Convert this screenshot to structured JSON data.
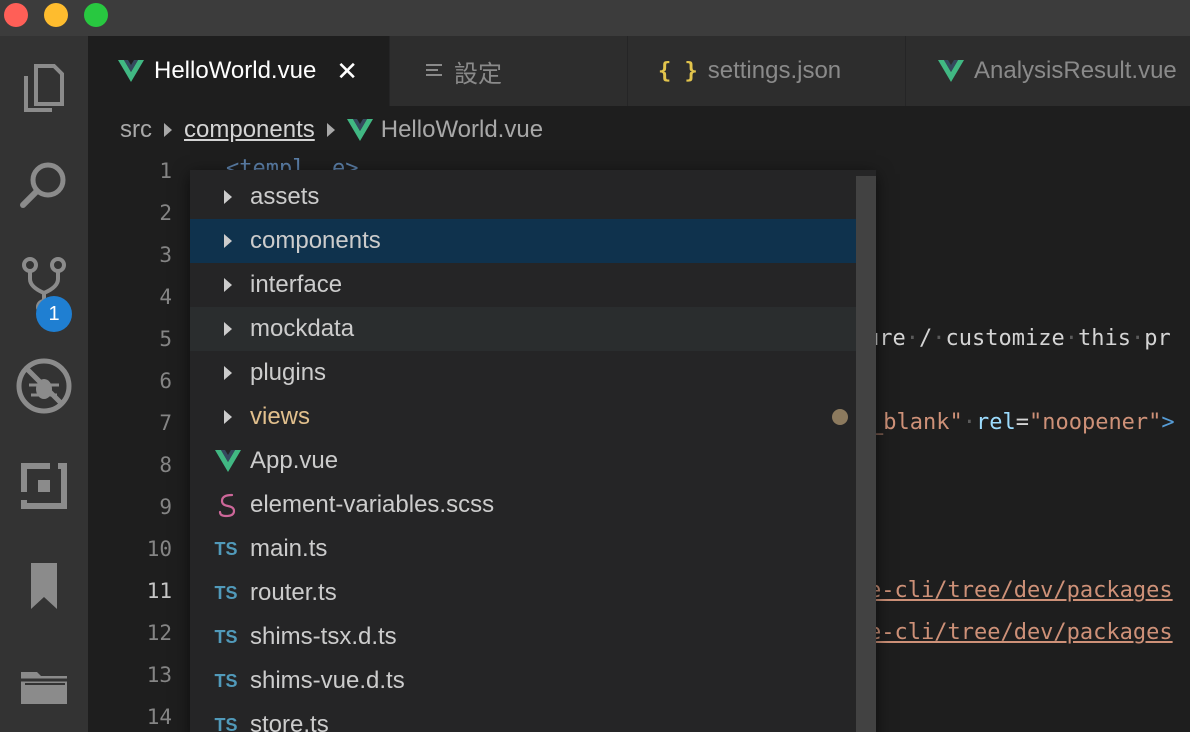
{
  "tabs": [
    {
      "label": "HelloWorld.vue",
      "icon": "vue-icon",
      "active": true,
      "close": "✕"
    },
    {
      "label": "設定",
      "icon": "settings-list-icon",
      "active": false
    },
    {
      "label": "settings.json",
      "icon": "json-braces-icon",
      "active": false,
      "icon_text": "{ }"
    },
    {
      "label": "AnalysisResult.vue",
      "icon": "vue-icon",
      "active": false
    }
  ],
  "breadcrumb": {
    "items": [
      "src",
      "components",
      "HelloWorld.vue"
    ]
  },
  "activity_bar": {
    "items": [
      "explorer-icon",
      "search-icon",
      "source-control-icon",
      "debug-icon",
      "extensions-icon",
      "bookmark-icon",
      "folder-icon"
    ],
    "scm_badge": "1"
  },
  "gutter": {
    "lines": [
      "1",
      "2",
      "3",
      "4",
      "5",
      "6",
      "7",
      "8",
      "9",
      "10",
      "11",
      "12",
      "13",
      "14"
    ],
    "current_line": "11"
  },
  "code": {
    "line1": "<templ  e>",
    "line5_a": "ure",
    "line5_b": "/",
    "line5_c": "customize",
    "line5_d": "this",
    "line5_e": "pr",
    "line7_a": "_blank\"",
    "line7_attr": "rel",
    "line7_eq": "=",
    "line7_str": "\"noopener\"",
    "line7_end": ">",
    "line11": "e-cli/tree/dev/packages",
    "line12": "e-cli/tree/dev/packages"
  },
  "dropdown": {
    "items": [
      {
        "label": "assets",
        "icon": "chevron-right-icon"
      },
      {
        "label": "components",
        "icon": "chevron-right-icon",
        "selected": true
      },
      {
        "label": "interface",
        "icon": "chevron-right-icon"
      },
      {
        "label": "mockdata",
        "icon": "chevron-right-icon",
        "hovered": true
      },
      {
        "label": "plugins",
        "icon": "chevron-right-icon"
      },
      {
        "label": "views",
        "icon": "chevron-right-icon",
        "modified": true
      },
      {
        "label": "App.vue",
        "icon": "vue-icon"
      },
      {
        "label": "element-variables.scss",
        "icon": "sass-icon"
      },
      {
        "label": "main.ts",
        "icon": "typescript-icon",
        "icon_text": "TS"
      },
      {
        "label": "router.ts",
        "icon": "typescript-icon",
        "icon_text": "TS"
      },
      {
        "label": "shims-tsx.d.ts",
        "icon": "typescript-icon",
        "icon_text": "TS"
      },
      {
        "label": "shims-vue.d.ts",
        "icon": "typescript-icon",
        "icon_text": "TS"
      },
      {
        "label": "store.ts",
        "icon": "typescript-icon",
        "icon_text": "TS"
      }
    ]
  },
  "colors": {
    "vue_green": "#41b883",
    "vue_dark": "#35495e",
    "selected_bg": "#0f324d",
    "modified": "#e2c08d",
    "ts_blue": "#519aba",
    "badge_blue": "#1f7fd2"
  }
}
